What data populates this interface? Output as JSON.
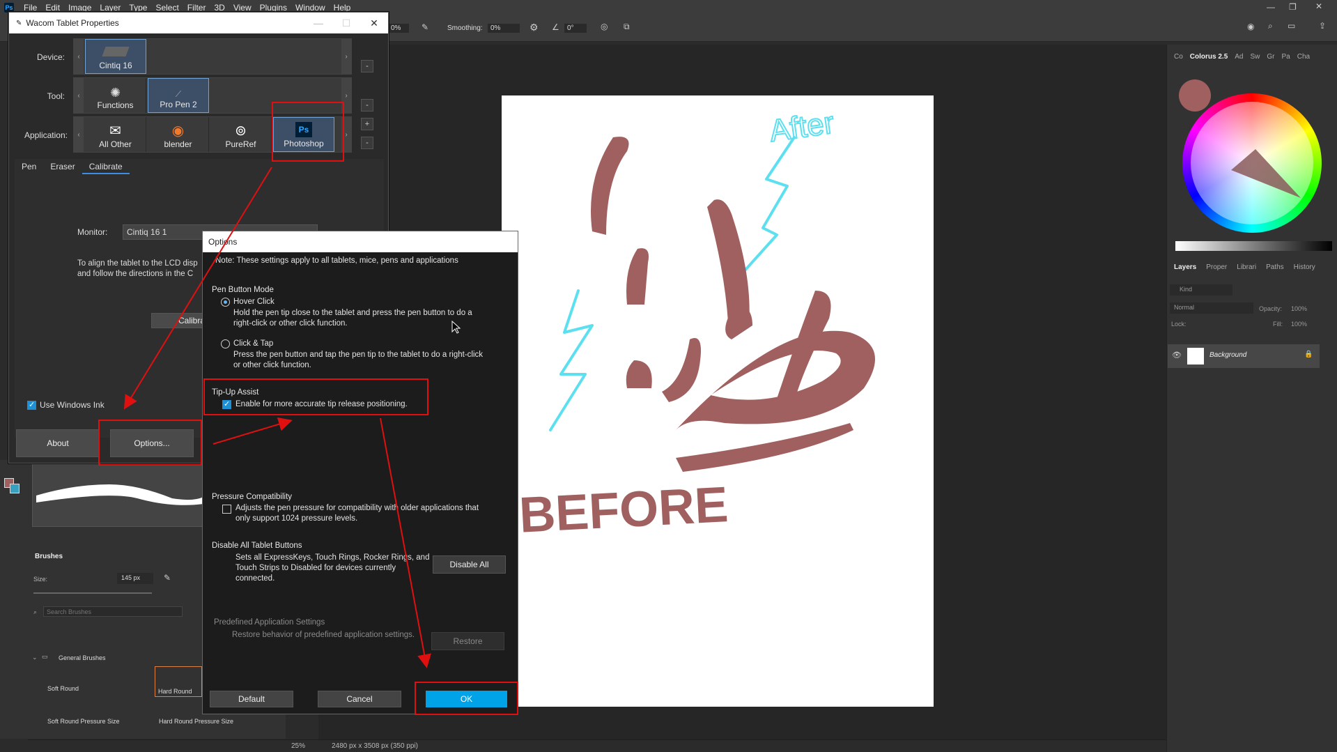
{
  "menubar": {
    "items": [
      "File",
      "Edit",
      "Image",
      "Layer",
      "Type",
      "Select",
      "Filter",
      "3D",
      "View",
      "Plugins",
      "Window",
      "Help"
    ]
  },
  "optbar": {
    "flow_value": "0%",
    "smoothing_label": "Smoothing:",
    "smoothing_value": "0%",
    "angle_value": "0°"
  },
  "right_panel": {
    "color_tabs": [
      "Co",
      "Colorus 2.5",
      "Ad",
      "Sw",
      "Gr",
      "Pa",
      "Cha"
    ],
    "layer_tabs": [
      "Layers",
      "Proper",
      "Librari",
      "Paths",
      "History"
    ],
    "kind_label": "Kind",
    "blend_mode": "Normal",
    "opacity_label": "Opacity:",
    "opacity_value": "100%",
    "lock_label": "Lock:",
    "fill_label": "Fill:",
    "fill_value": "100%",
    "layer_name": "Background"
  },
  "brushes": {
    "tab": "Brushes",
    "size_label": "Size:",
    "size_value": "145 px",
    "search_placeholder": "Search Brushes",
    "folder": "General Brushes",
    "items": [
      "Soft Round",
      "Hard Round",
      "Soft Round Pressure Size",
      "Hard Round Pressure Size"
    ]
  },
  "statusbar": {
    "zoom": "25%",
    "doc_info": "2480 px x 3508 px (350 ppi)"
  },
  "canvas_text": {
    "after": "After",
    "before": "BEFORE"
  },
  "wacom": {
    "title": "Wacom Tablet Properties",
    "device_label": "Device:",
    "tool_label": "Tool:",
    "application_label": "Application:",
    "devices": [
      "Cintiq 16"
    ],
    "tools": [
      "Functions",
      "Pro Pen 2"
    ],
    "applications": [
      "All Other",
      "blender",
      "PureRef",
      "Photoshop"
    ],
    "tabs": [
      "Pen",
      "Eraser",
      "Calibrate"
    ],
    "monitor_label": "Monitor:",
    "monitor_value": "Cintiq 16 1",
    "calib_text_1": "To align the tablet to the LCD disp",
    "calib_text_2": "and follow the directions in the C",
    "calibrate_btn": "Calibra",
    "use_windows_ink": "Use Windows Ink",
    "about_btn": "About",
    "options_btn": "Options..."
  },
  "options": {
    "title": "Options",
    "note": "Note: These settings apply to all tablets, mice, pens and applications",
    "pen_button_mode": "Pen Button Mode",
    "hover_click": "Hover Click",
    "hover_desc_1": "Hold the pen tip close to the tablet and press the pen button to do a",
    "hover_desc_2": "right-click or other click function.",
    "click_tap": "Click & Tap",
    "click_desc_1": "Press the pen button and tap the pen tip to the tablet to do a right-click",
    "click_desc_2": "or other click function.",
    "tip_up_assist": "Tip-Up Assist",
    "tip_up_desc": "Enable for more accurate tip release positioning.",
    "pressure_compat": "Pressure Compatibility",
    "pressure_desc_1": "Adjusts the pen pressure for compatibility with older applications that",
    "pressure_desc_2": "only support 1024 pressure levels.",
    "disable_all_head": "Disable All Tablet Buttons",
    "disable_desc_1": "Sets all ExpressKeys, Touch Rings, Rocker Rings, and",
    "disable_desc_2": "Touch Strips to Disabled for devices currently",
    "disable_desc_3": "connected.",
    "disable_all_btn": "Disable All",
    "predefined_head": "Predefined Application Settings",
    "predefined_desc": "Restore behavior of predefined application settings.",
    "restore_btn": "Restore",
    "default_btn": "Default",
    "cancel_btn": "Cancel",
    "ok_btn": "OK"
  },
  "colors": {
    "accent": "#00a2e8",
    "annotation_red": "#e01010",
    "paint": "#a06060",
    "cyan": "#5ce0f0"
  }
}
